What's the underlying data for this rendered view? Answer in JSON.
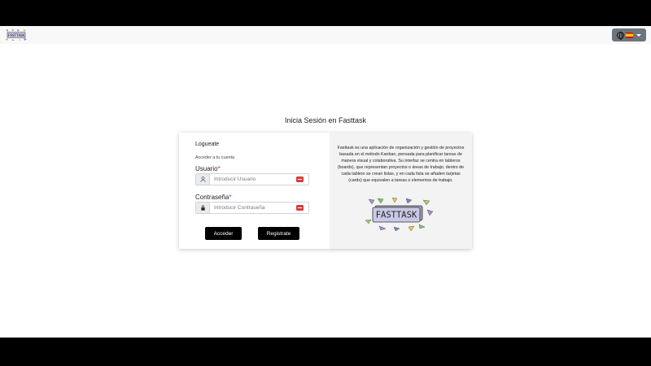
{
  "header": {
    "logo_text": "FASTTASK",
    "language_button": {
      "globe_icon": "globe-icon",
      "flag_icon": "spain-flag-icon",
      "caret_icon": "chevron-down-icon"
    }
  },
  "page_title": "Inicia Sesión en Fasttask",
  "login": {
    "subtitle": "Logueate",
    "access_text": "Acceder a tu cuenta",
    "username": {
      "label": "Usuario",
      "required_mark": "*",
      "placeholder": "Introducir Usuario",
      "icon": "user-icon"
    },
    "password": {
      "label": "Contraseña",
      "required_mark": "*",
      "placeholder": "Introducir Contraseña",
      "icon": "lock-icon"
    },
    "login_button": "Acceder",
    "register_button": "Registrate"
  },
  "info": {
    "description": "Fasttask es una aplicación de organización y gestión de proyectos basada en el método Kanban, pensada para planificar tareas de manera visual y colaborativa. Su interfaz se centra en tableros (boards), que representan proyectos o áreas de trabajo; dentro de cada tablero se crean listas, y en cada lista se añaden tarjetas (cards) que equivalen a tareas o elementos de trabajo.",
    "logo_text": "FASTTASK"
  },
  "colors": {
    "button_bg": "#000000",
    "card_right_bg": "#f4f3f4",
    "required": "#d0202f",
    "password_manager_badge": "#d93b3b",
    "language_button_bg": "#6c757d"
  }
}
